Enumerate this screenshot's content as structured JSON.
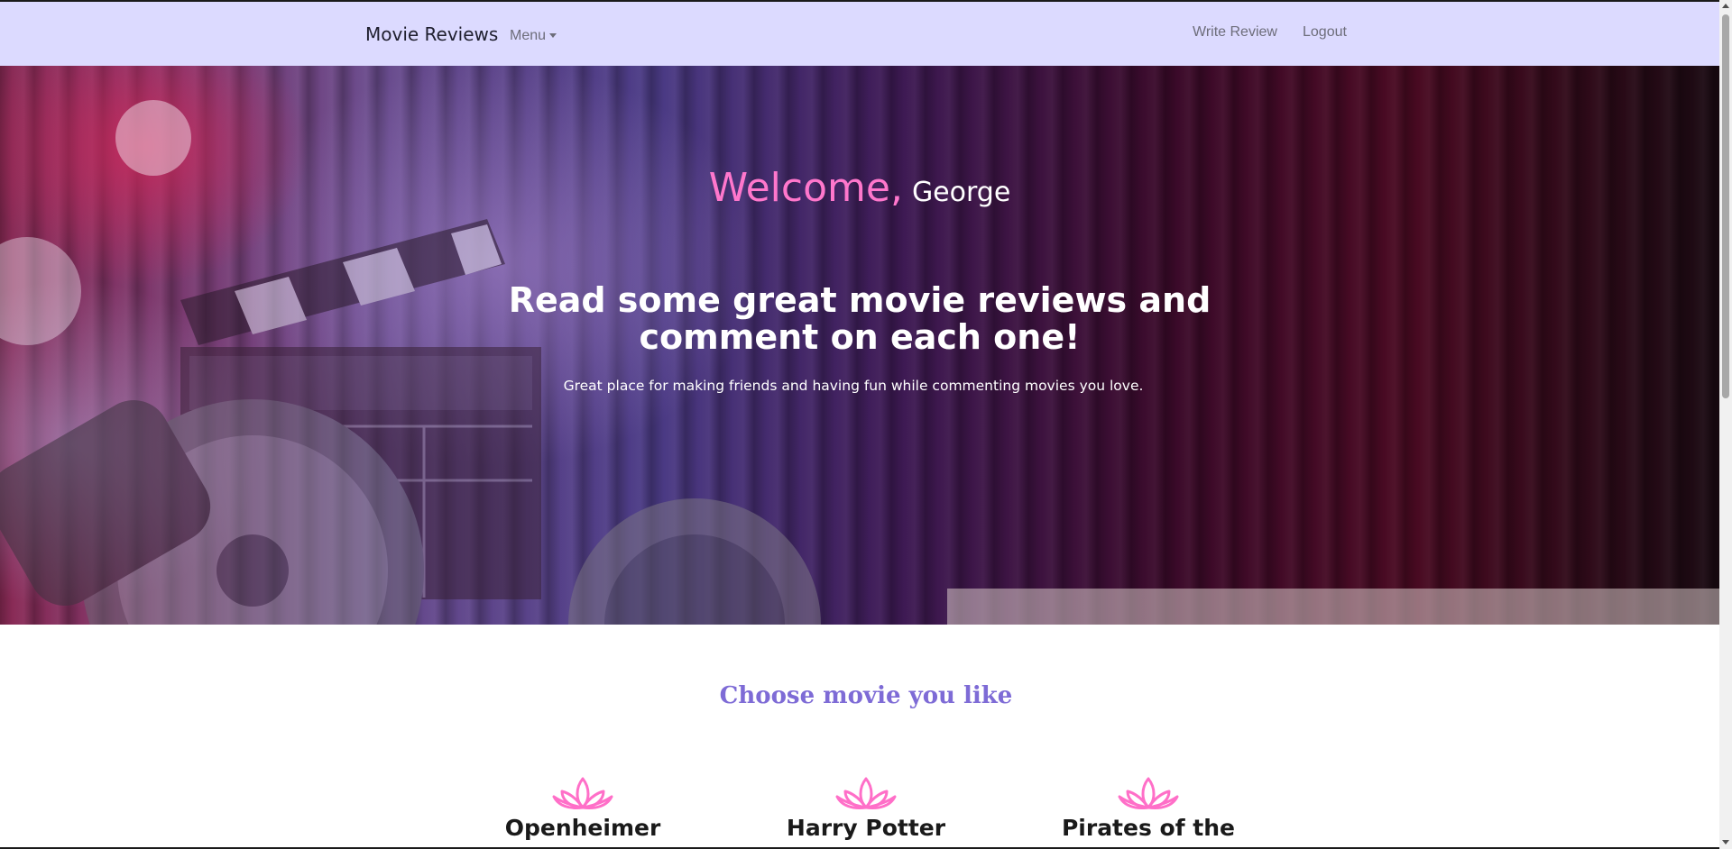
{
  "nav": {
    "brand": "Movie Reviews",
    "menu_label": "Menu",
    "links": [
      "Write Review",
      "Logout"
    ]
  },
  "hero": {
    "welcome_word": "Welcome,",
    "user_name": "George",
    "title": "Read some great movie reviews and comment on each one!",
    "subtitle": "Great place for making friends and having fun while commenting movies you love."
  },
  "section": {
    "title": "Choose movie you like"
  },
  "movies": [
    {
      "title": "Openheimer",
      "icon": "lotus-icon"
    },
    {
      "title": "Harry Potter",
      "icon": "lotus-icon"
    },
    {
      "title": "Pirates of the",
      "icon": "lotus-icon"
    }
  ],
  "colors": {
    "navbar_bg": "#dcdaff",
    "welcome_accent": "#ff77cc",
    "section_title": "#7e6bd6",
    "icon_accent": "#ff6fc8"
  }
}
